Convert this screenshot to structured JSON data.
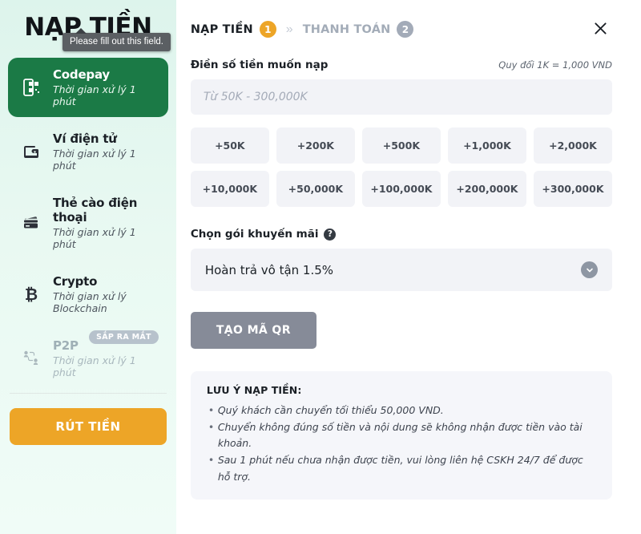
{
  "sidebar": {
    "brand": "NẠP TIỀN",
    "methods": [
      {
        "title": "Codepay",
        "sub": "Thời gian xử lý 1 phút",
        "icon": "codepay-qr-icon",
        "state": "active",
        "badge": ""
      },
      {
        "title": "Ví điện tử",
        "sub": "Thời gian xử lý 1 phút",
        "icon": "wallet-icon",
        "state": "default",
        "badge": ""
      },
      {
        "title": "Thẻ cào điện thoại",
        "sub": "Thời gian xử lý 1 phút",
        "icon": "card-stack-icon",
        "state": "default",
        "badge": ""
      },
      {
        "title": "Crypto",
        "sub": "Thời gian xử lý Blockchain",
        "icon": "bitcoin-icon",
        "state": "default",
        "badge": ""
      },
      {
        "title": "P2P",
        "sub": "Thời gian xử lý 1 phút",
        "icon": "p2p-users-icon",
        "state": "disabled",
        "badge": "SẮP RA MẮT"
      }
    ],
    "withdraw_label": "RÚT TIỀN"
  },
  "tooltip": {
    "text": "Please fill out this field."
  },
  "header": {
    "step1_label": "NẠP TIỀN",
    "step1_num": "1",
    "separator": "»",
    "step2_label": "THANH TOÁN",
    "step2_num": "2",
    "close_icon": "close-icon"
  },
  "amount": {
    "label": "Điền số tiền muốn nạp",
    "note": "Quy đổi 1K = 1,000 VND",
    "placeholder": "Từ 50K - 300,000K",
    "value": "",
    "quick_amounts": [
      "+50K",
      "+200K",
      "+500K",
      "+1,000K",
      "+2,000K",
      "+10,000K",
      "+50,000K",
      "+100,000K",
      "+200,000K",
      "+300,000K"
    ]
  },
  "promo": {
    "label": "Chọn gói khuyến mãi",
    "help_icon": "help-circle-icon",
    "selected": "Hoàn trả vô tận 1.5%",
    "chevron_icon": "chevron-down-icon"
  },
  "submit": {
    "label": "TẠO MÃ QR"
  },
  "notes": {
    "title": "LƯU Ý NẠP TIỀN:",
    "lines": [
      "Quý khách cần chuyển tối thiểu 50,000 VND.",
      "Chuyển không đúng số tiền và nội dung sẽ không nhận được tiền vào tài khoản.",
      "Sau 1 phút nếu chưa nhận được tiền, vui lòng liên hệ CSKH 24/7 để được hỗ trợ."
    ]
  },
  "colors": {
    "accent_orange": "#eda527",
    "active_green": "#1b7a46",
    "field_bg": "#f2f3f7",
    "muted_gray": "#868b98"
  }
}
